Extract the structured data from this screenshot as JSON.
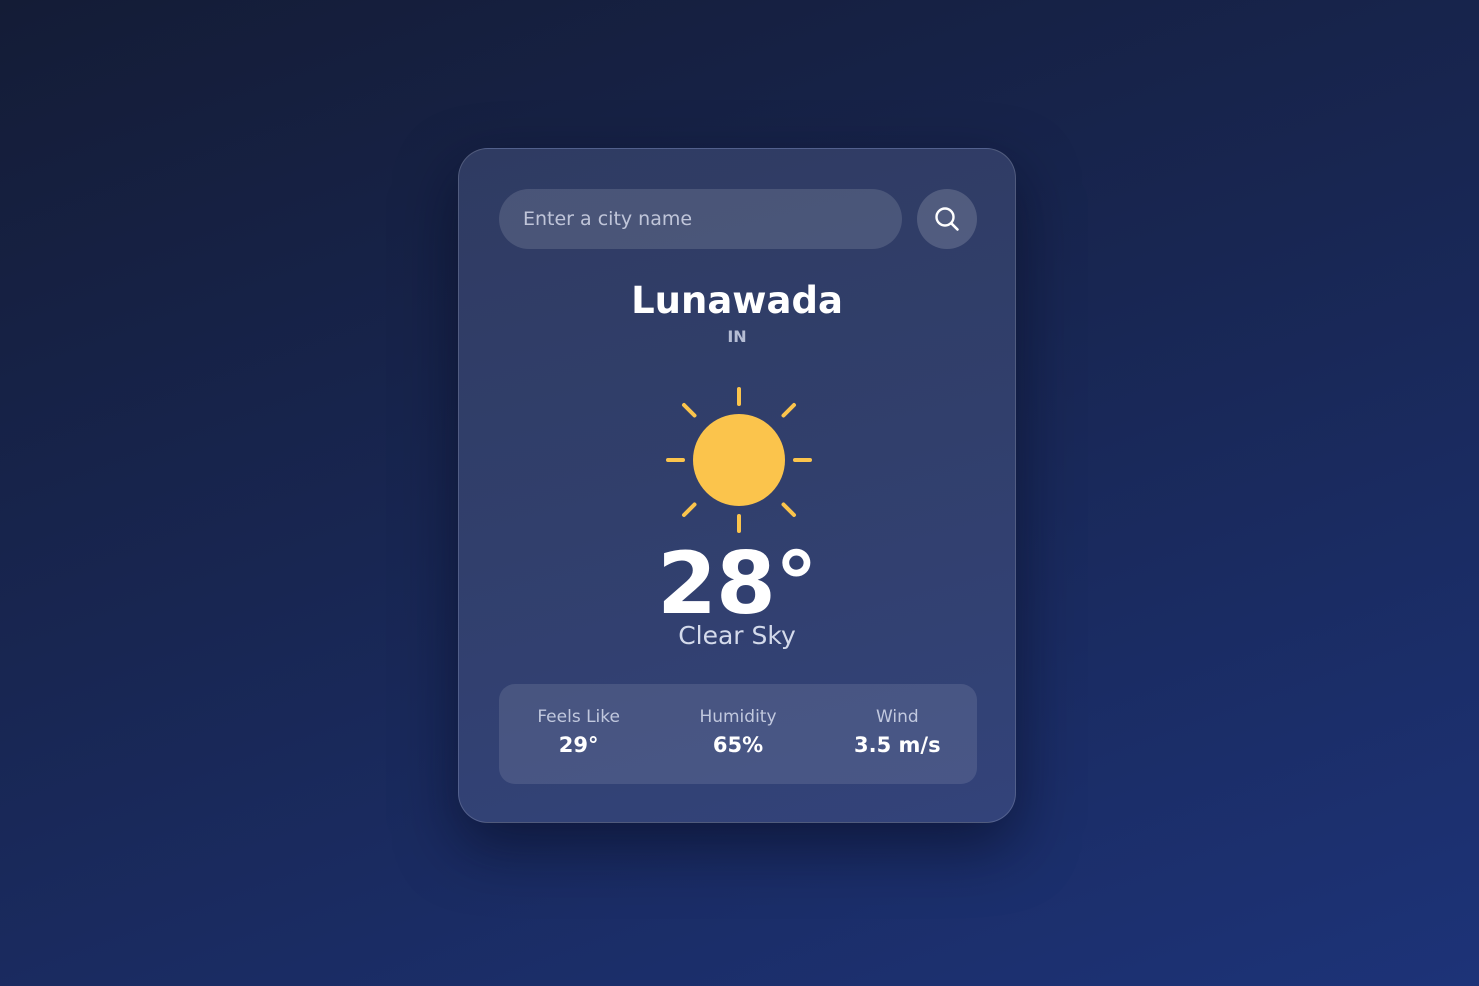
{
  "search": {
    "placeholder": "Enter a city name",
    "value": "",
    "button_icon": "search-icon"
  },
  "location": {
    "city": "Lunawada",
    "country": "IN"
  },
  "weather": {
    "icon": "sun-icon",
    "icon_color": "#fbc44c",
    "temperature": "28°",
    "description": "Clear Sky"
  },
  "details": [
    {
      "label": "Feels Like",
      "value": "29°"
    },
    {
      "label": "Humidity",
      "value": "65%"
    },
    {
      "label": "Wind",
      "value": "3.5 m/s"
    }
  ],
  "colors": {
    "background_top": "#141c36",
    "background_bottom": "#1d3378",
    "card": "#313f6c",
    "accent": "#fbc44c"
  }
}
